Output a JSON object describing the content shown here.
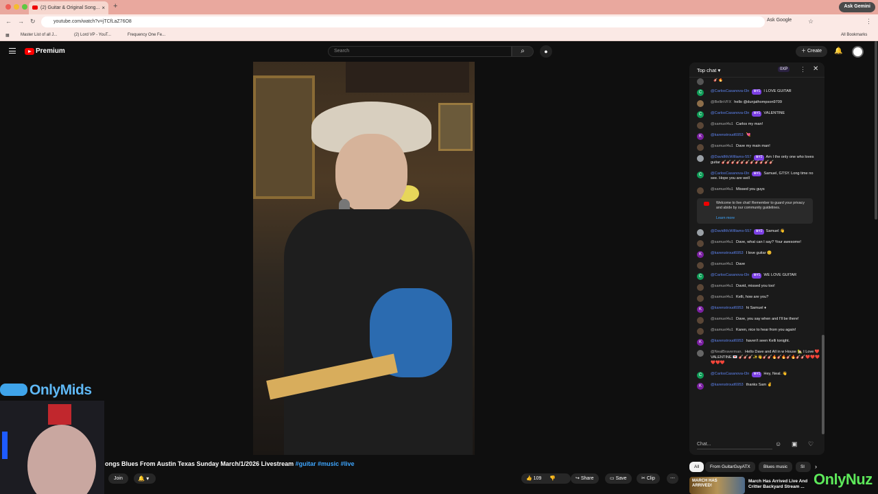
{
  "browser": {
    "tab_title": "(2) Guitar & Original Song...",
    "url": "youtube.com/watch?v=jTCfLaZ76O8",
    "ask_google": "Ask Google",
    "ask_gemini": "Ask Gemini",
    "bookmarks": [
      "Master List of all J...",
      "(2) Lord VP - YouT...",
      "Frequency One Fe..."
    ],
    "all_bookmarks": "All Bookmarks"
  },
  "header": {
    "logo_text": "Premium",
    "search_placeholder": "Search",
    "create_label": "Create",
    "notification_count": "9+"
  },
  "video": {
    "title_text": "ongs Blues From Austin Texas Sunday March/1/2026 Livestream",
    "hashtags": "#guitar #music #live",
    "join_label": "Join",
    "like_count": "109",
    "share_label": "Share",
    "save_label": "Save",
    "clip_label": "Clip"
  },
  "overlay": {
    "left_brand": "OnlyMids",
    "right_brand": "OnlyNuz"
  },
  "chat": {
    "header_label": "Top chat",
    "xp_label": "0XP",
    "input_placeholder": "Chat...",
    "messages": [
      {
        "author": "",
        "text": "🎸🔥",
        "member": false,
        "badge": "",
        "color": "#555",
        "initial": ""
      },
      {
        "author": "@CarlosCasanova-l3n",
        "text": "I LOVE GUITAR",
        "member": true,
        "badge": "♛#1",
        "color": "#0f9d58",
        "initial": "C"
      },
      {
        "author": "@BellinVFX",
        "text": "hello @dunjathompson9709",
        "member": false,
        "badge": "",
        "color": "#8d6e4a",
        "initial": ""
      },
      {
        "author": "@CarlosCasanova-l3n",
        "text": "VALENTINE",
        "member": true,
        "badge": "♛#1",
        "color": "#0f9d58",
        "initial": "C"
      },
      {
        "author": "@samuel4u1",
        "text": "Carlos my man!",
        "member": false,
        "badge": "",
        "color": "#5a4636",
        "initial": ""
      },
      {
        "author": "@karenstroud6953",
        "text": "💘",
        "member": true,
        "badge": "",
        "color": "#7b1fa2",
        "initial": "K"
      },
      {
        "author": "@samuel4u1",
        "text": "Dave my main man!",
        "member": false,
        "badge": "",
        "color": "#5a4636",
        "initial": ""
      },
      {
        "author": "@DavidMcWilliams-557",
        "text": "Am I the only one who loves guitar 🎸🎸🎸🎸🎸🎸🎸🎸🎸🎸🎸",
        "member": true,
        "badge": "♛#2",
        "color": "#9aa0a6",
        "initial": ""
      },
      {
        "author": "@CarlosCasanova-l3n",
        "text": "Samuel, GTSY. Long time no see. Hope you are well",
        "member": true,
        "badge": "♛#1",
        "color": "#0f9d58",
        "initial": "C"
      },
      {
        "author": "@samuel4u1",
        "text": "Missed you guys",
        "member": false,
        "badge": "",
        "color": "#5a4636",
        "initial": ""
      }
    ],
    "notice": {
      "text": "Welcome to live chat! Remember to guard your privacy and abide by our community guidelines.",
      "link": "Learn more"
    },
    "messages2": [
      {
        "author": "@DavidMcWilliams-557",
        "text": "Samuel 👋",
        "member": true,
        "badge": "♛#2",
        "color": "#9aa0a6",
        "initial": ""
      },
      {
        "author": "@samuel4u1",
        "text": "Dave, what can I say? Your awesome!",
        "member": false,
        "badge": "",
        "color": "#5a4636",
        "initial": ""
      },
      {
        "author": "@karenstroud6953",
        "text": "I love guitar 😊",
        "member": true,
        "badge": "",
        "color": "#7b1fa2",
        "initial": "K"
      },
      {
        "author": "@samuel4u1",
        "text": "Dave",
        "member": false,
        "badge": "",
        "color": "#5a4636",
        "initial": ""
      },
      {
        "author": "@CarlosCasanova-l3n",
        "text": "WE LOVE GUITAR",
        "member": true,
        "badge": "♛#1",
        "color": "#0f9d58",
        "initial": "C"
      },
      {
        "author": "@samuel4u1",
        "text": "David, missed you too!",
        "member": false,
        "badge": "",
        "color": "#5a4636",
        "initial": ""
      },
      {
        "author": "@samuel4u1",
        "text": "Kelli, how are you?",
        "member": false,
        "badge": "",
        "color": "#5a4636",
        "initial": ""
      },
      {
        "author": "@karenstroud6953",
        "text": "hi Samuel ♦",
        "member": true,
        "badge": "",
        "color": "#7b1fa2",
        "initial": "K"
      },
      {
        "author": "@samuel4u1",
        "text": "Dave, you say when and I'll be there!",
        "member": false,
        "badge": "",
        "color": "#5a4636",
        "initial": ""
      },
      {
        "author": "@samuel4u1",
        "text": "Karen, nice to hear from you again!",
        "member": false,
        "badge": "",
        "color": "#5a4636",
        "initial": ""
      },
      {
        "author": "@karenstroud6953",
        "text": "haven't seen Kelli tonight.",
        "member": true,
        "badge": "",
        "color": "#7b1fa2",
        "initial": "K"
      },
      {
        "author": "@NealBraverman.",
        "text": "Hello Dave and All in w House 🏡 I Love ❤️ VALENTINE 💌 🎸🎸🎸✨👋🎸🎸🔥🎸🔥🎸🔥🎸🎸❤️❤️❤️❤️❤️❤️",
        "member": false,
        "badge": "",
        "color": "#666",
        "initial": ""
      },
      {
        "author": "@CarlosCasanova-l3n",
        "text": "Hey, Neal. 👋",
        "member": true,
        "badge": "♛#1",
        "color": "#0f9d58",
        "initial": "C"
      },
      {
        "author": "@karenstroud6953",
        "text": "thanks Sam ✌",
        "member": true,
        "badge": "",
        "color": "#7b1fa2",
        "initial": "K"
      }
    ]
  },
  "chips": [
    "All",
    "From GuitarGuyATX",
    "Blues music",
    "Sl"
  ],
  "recommended": {
    "thumb_text": "MARCH HAS ARRIVED!",
    "title": "March Has Arrived Live And Critter Backyard Stream ..."
  }
}
